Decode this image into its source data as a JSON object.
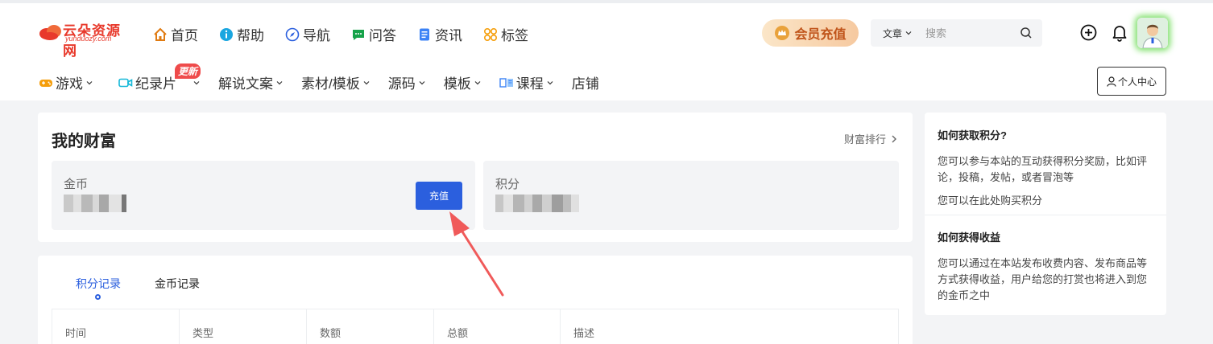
{
  "brand": {
    "logo_text": "云朵资源网",
    "logo_sub": "yunduozy.com",
    "accent": "#2b5fde",
    "logo_color": "#e8392b"
  },
  "topnav": [
    {
      "label": "首页",
      "icon": "home-icon"
    },
    {
      "label": "帮助",
      "icon": "info-icon"
    },
    {
      "label": "导航",
      "icon": "compass-icon"
    },
    {
      "label": "问答",
      "icon": "chat-icon"
    },
    {
      "label": "资讯",
      "icon": "document-icon"
    },
    {
      "label": "标签",
      "icon": "tags-icon"
    }
  ],
  "vip": {
    "label": "会员充值",
    "icon": "crown-icon"
  },
  "search": {
    "scope": "文章",
    "placeholder": "搜索"
  },
  "subnav": [
    {
      "label": "游戏",
      "icon": "gamepad-icon",
      "chevron": true
    },
    {
      "label": "纪录片",
      "icon": "video-icon",
      "chevron": true,
      "badge": "更新"
    },
    {
      "label": "解说文案",
      "chevron": true
    },
    {
      "label": "素材/模板",
      "chevron": true
    },
    {
      "label": "源码",
      "chevron": true
    },
    {
      "label": "模板",
      "chevron": true
    },
    {
      "label": "课程",
      "icon": "book-icon",
      "chevron": true
    },
    {
      "label": "店铺",
      "chevron": false
    }
  ],
  "user_center": "个人中心",
  "wealth": {
    "title": "我的财富",
    "rank_link": "财富排行",
    "coin_label": "金币",
    "recharge": "充值",
    "points_label": "积分"
  },
  "records": {
    "tabs": [
      "积分记录",
      "金币记录"
    ],
    "active_tab": 0,
    "columns": [
      "时间",
      "类型",
      "数额",
      "总额",
      "描述"
    ]
  },
  "sidebar": {
    "points": {
      "title": "如何获取积分?",
      "text": "您可以参与本站的互动获得积分奖励，比如评论，投稿，发帖，或者冒泡等",
      "text2": "您可以在此处购买积分"
    },
    "earnings": {
      "title": "如何获得收益",
      "text": "您可以通过在本站发布收费内容、发布商品等方式获得收益，用户给您的打赏也将进入到您的金币之中"
    }
  }
}
